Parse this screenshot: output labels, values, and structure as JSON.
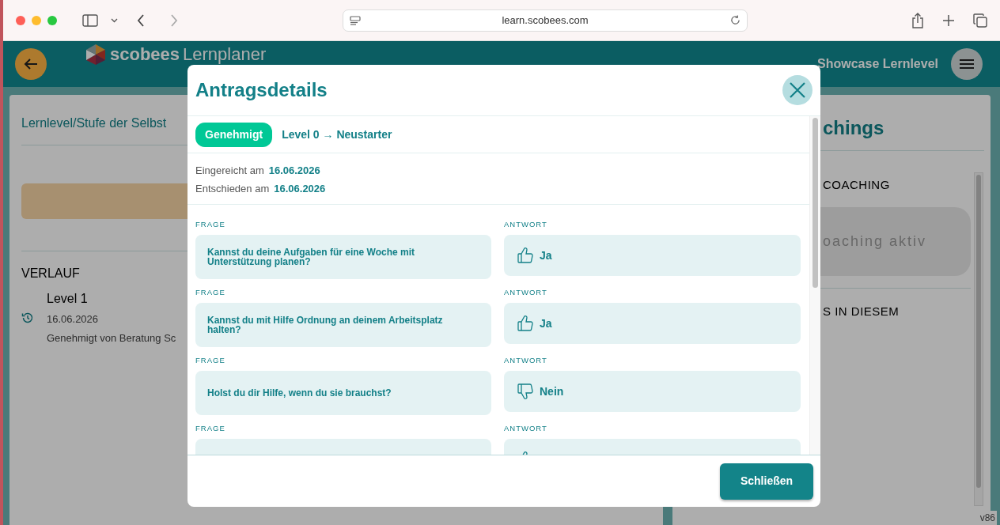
{
  "browser": {
    "url": "learn.scobees.com"
  },
  "header": {
    "brand": "scobees",
    "app_name": "Lernplaner",
    "user": "Showcase Lernlevel"
  },
  "left_panel": {
    "title": "Lernlevel/Stufe der Selbst",
    "history_title": "VERLAUF",
    "history": [
      {
        "level": "Level 1",
        "date": "16.06.2026",
        "note": "Genehmigt von Beratung Sc"
      }
    ]
  },
  "right_panel": {
    "title": "chings",
    "section_1": "COACHING",
    "status": "oaching aktiv",
    "section_2": "S IN DIESEM"
  },
  "version": "v86",
  "modal": {
    "title": "Antragsdetails",
    "status": "Genehmigt",
    "transition": {
      "from": "Level 0",
      "arrow": "→",
      "to": "Neustarter"
    },
    "dates": [
      {
        "label": "Eingereicht am",
        "value": "16.06.2026"
      },
      {
        "label": "Entschieden am",
        "value": "16.06.2026"
      }
    ],
    "items": [
      {
        "question_label": "FRAGE",
        "question": "Kannst du deine Aufgaben für eine Woche mit Unterstützung planen?",
        "answer_label": "ANTWORT",
        "answer": "Ja",
        "kind": "yes"
      },
      {
        "question_label": "FRAGE",
        "question": "Kannst du mit Hilfe Ordnung an deinem Arbeitsplatz halten?",
        "answer_label": "ANTWORT",
        "answer": "Ja",
        "kind": "yes"
      },
      {
        "question_label": "FRAGE",
        "question": "Holst du dir Hilfe, wenn du sie brauchst?",
        "answer_label": "ANTWORT",
        "answer": "Nein",
        "kind": "no"
      },
      {
        "question_label": "FRAGE",
        "answer_label": "ANTWORT",
        "kind": "yes"
      }
    ],
    "close_button": "Schließen"
  }
}
